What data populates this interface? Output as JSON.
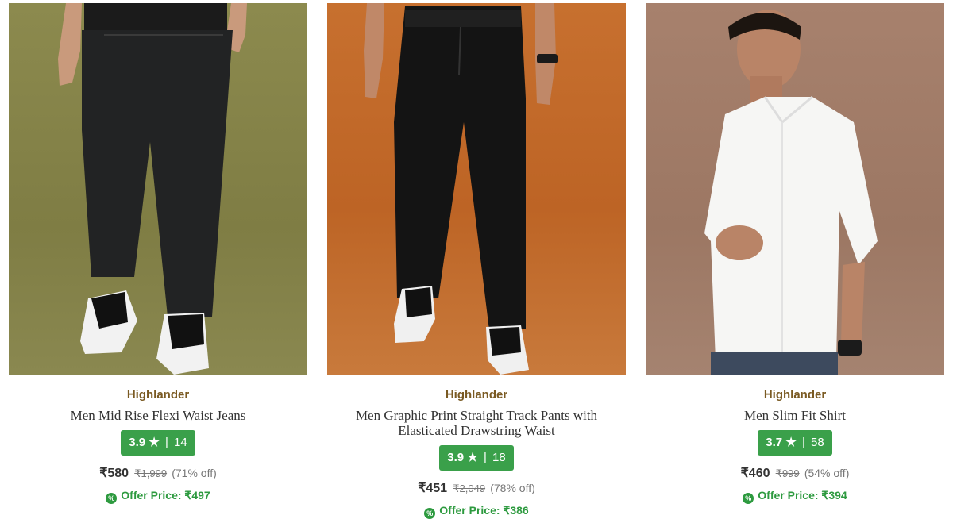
{
  "products": [
    {
      "brand": "Highlander",
      "name": "Men Mid Rise Flexi Waist Jeans",
      "rating": "3.9",
      "star_icon": "star-icon",
      "separator": "|",
      "review_count": "14",
      "price": "₹580",
      "mrp": "₹1,999",
      "discount": "(71% off)",
      "offer_label": "Offer Price: ₹497",
      "image_icon": "jeans-product-photo",
      "background_color": "#8a884c"
    },
    {
      "brand": "Highlander",
      "name": "Men Graphic Print Straight Track Pants with Elasticated Drawstring Waist",
      "rating": "3.9",
      "star_icon": "star-icon",
      "separator": "|",
      "review_count": "18",
      "price": "₹451",
      "mrp": "₹2,049",
      "discount": "(78% off)",
      "offer_label": "Offer Price: ₹386",
      "image_icon": "track-pants-product-photo",
      "background_color": "#c26a2b"
    },
    {
      "brand": "Highlander",
      "name": "Men Slim Fit Shirt",
      "rating": "3.7",
      "star_icon": "star-icon",
      "separator": "|",
      "review_count": "58",
      "price": "₹460",
      "mrp": "₹999",
      "discount": "(54% off)",
      "offer_label": "Offer Price: ₹394",
      "image_icon": "shirt-product-photo",
      "background_color": "#a17c68"
    }
  ],
  "colors": {
    "brand_text": "#7a5a22",
    "rating_badge": "#3aa04a",
    "offer_text": "#2d9a3f"
  },
  "glyphs": {
    "star": "★",
    "offer": "%"
  }
}
